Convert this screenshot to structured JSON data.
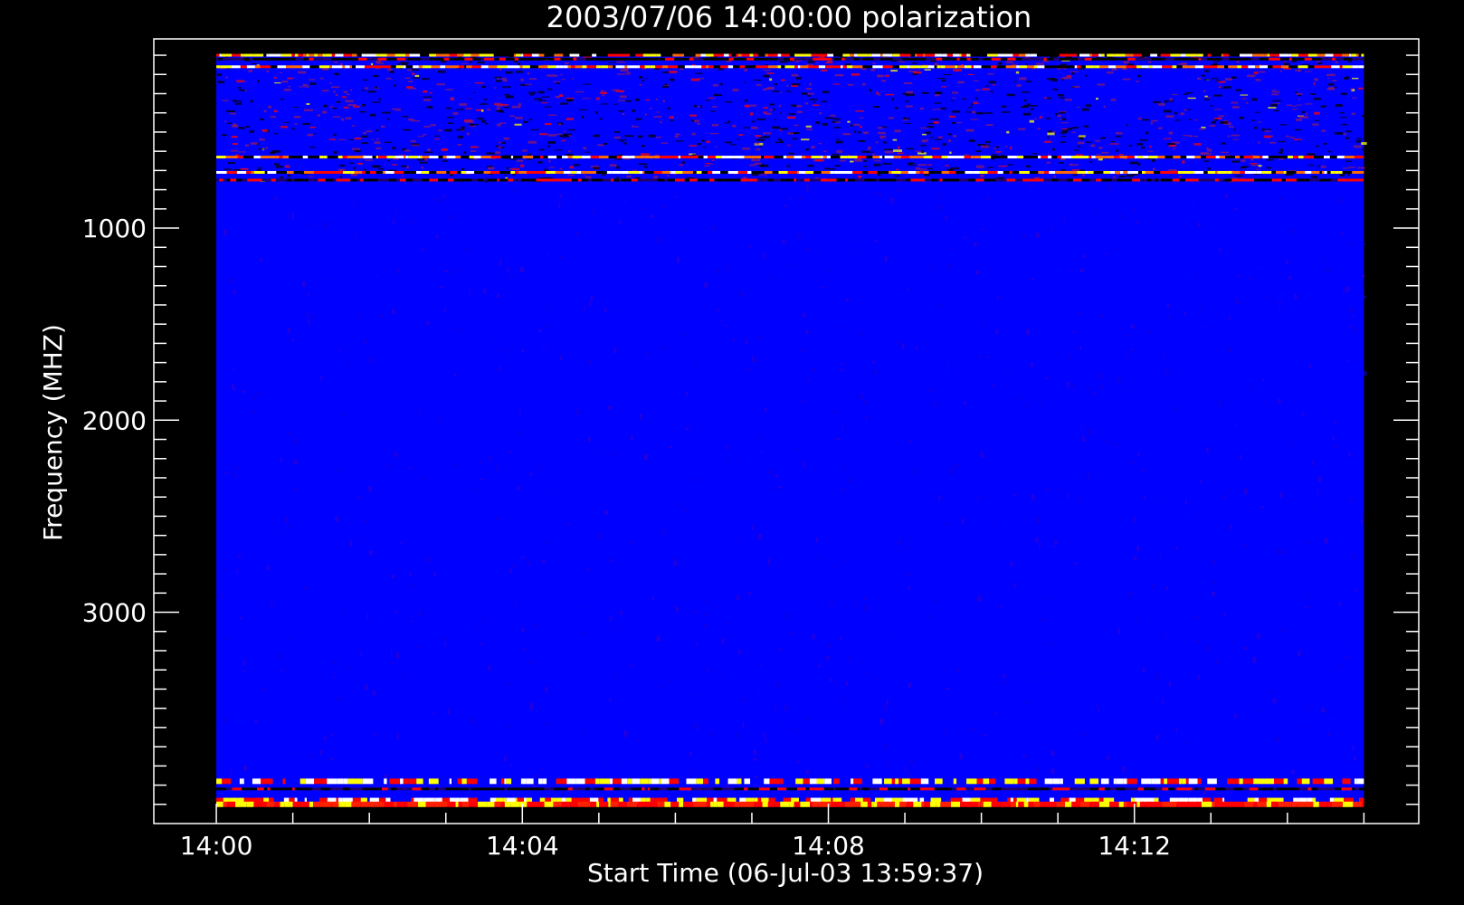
{
  "chart_data": {
    "type": "heatmap",
    "title": "2003/07/06 14:00:00 polarization",
    "xlabel": "Start Time (06-Jul-03 13:59:37)",
    "ylabel": "Frequency (MHZ)",
    "x_ticks": [
      "14:00",
      "14:04",
      "14:08",
      "14:12"
    ],
    "y_ticks": [
      "1000",
      "2000",
      "3000"
    ],
    "xlim_minutes_after_1400": [
      -0.817,
      15.717
    ],
    "ylim_mhz": [
      4100,
      15
    ],
    "data_time_range": [
      "14:00",
      "14:15"
    ],
    "data_freq_range_mhz": [
      100,
      4000
    ],
    "background_color": "#0000ff",
    "frame_color": "#ffffff",
    "colorscale": [
      "#000000",
      "#0000ff",
      "#ff0000",
      "#ffff00",
      "#ffffff"
    ],
    "bright_bands_mhz": [
      100,
      160,
      630,
      710,
      3880,
      3980,
      4000
    ],
    "dark_bands_mhz": [
      120,
      750,
      3920
    ]
  }
}
